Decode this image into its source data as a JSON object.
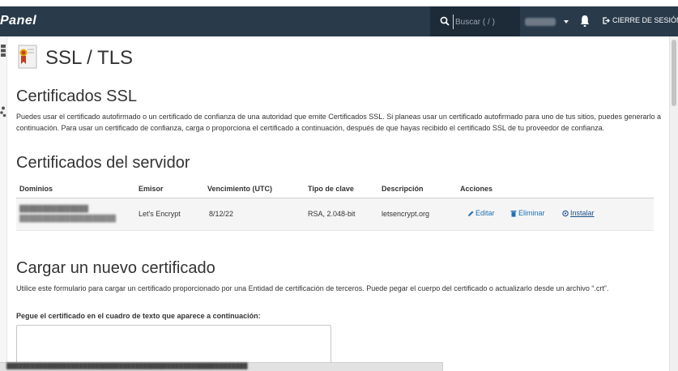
{
  "topbar": {
    "logo": "Panel",
    "search_placeholder": "Buscar ( / )",
    "logout_label": "CIERRE DE SESIÓN"
  },
  "page": {
    "title": "SSL / TLS"
  },
  "ssl_section": {
    "heading": "Certificados SSL",
    "description": "Puedes usar el certificado autofirmado o un certificado de confianza de una autoridad que emite Certificados SSL. Si planeas usar un certificado autofirmado para uno de tus sitios, puedes generarlo a continuación. Para usar un certificado de confianza, carga o proporciona el certificado a continuación, después de que hayas recibido el certificado SSL de tu proveedor de confianza."
  },
  "server_certs": {
    "heading": "Certificados del servidor",
    "columns": {
      "domains": "Dominios",
      "issuer": "Emisor",
      "expiry": "Vencimiento (UTC)",
      "key_type": "Tipo de clave",
      "description": "Descripción",
      "actions": "Acciones"
    },
    "rows": [
      {
        "issuer": "Let's Encrypt",
        "expiry": "8/12/22",
        "key_type": "RSA, 2.048-bit",
        "description": "letsencrypt.org",
        "edit_label": "Editar",
        "delete_label": "Eliminar",
        "install_label": "Instalar"
      }
    ]
  },
  "upload": {
    "heading": "Cargar un nuevo certificado",
    "description": "Utilice este formulario para cargar un certificado proporcionado por una Entidad de certificación de terceros. Puede pegar el cuerpo del certificado o actualizarlo desde un archivo “.crt”.",
    "textarea_label": "Pegue el certificado en el cuadro de texto que aparece a continuación:",
    "textarea_value": ""
  },
  "icons": {
    "search": "search-icon",
    "bell": "bell-icon",
    "logout": "logout-icon",
    "edit": "pencil-icon",
    "delete": "trash-icon",
    "install": "install-icon",
    "page": "certificate-icon"
  },
  "colors": {
    "topbar": "#293a4a",
    "link": "#1f6fb2",
    "row_bg": "#f5f5f5"
  }
}
